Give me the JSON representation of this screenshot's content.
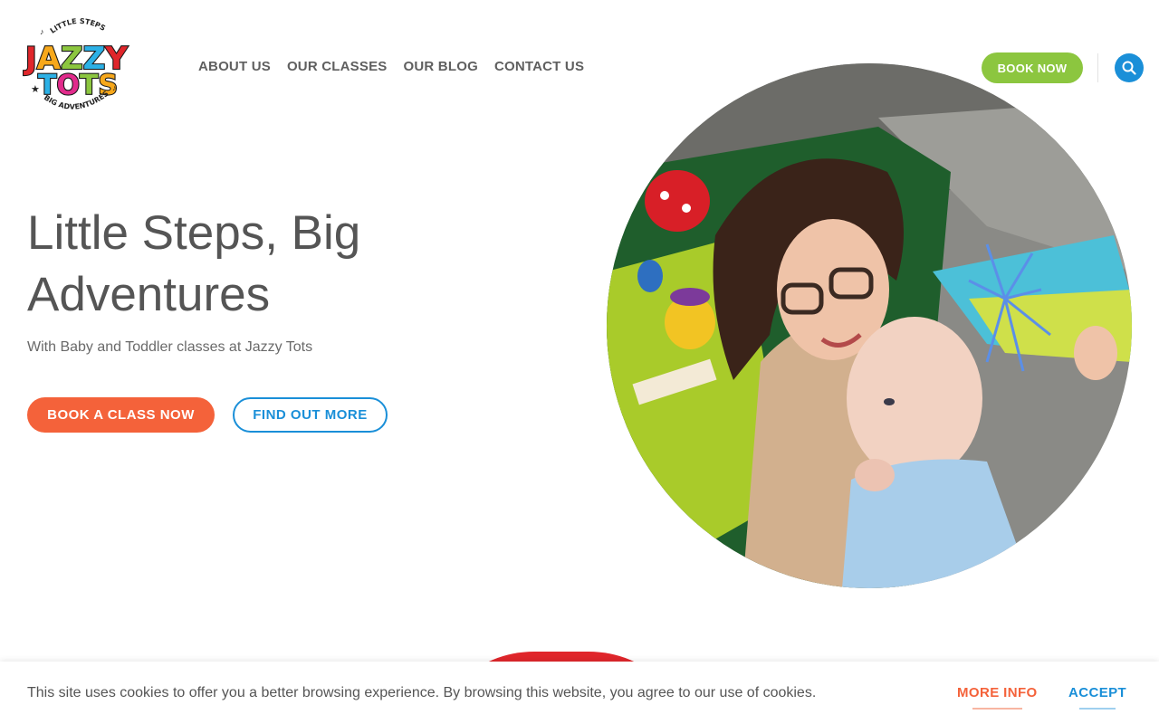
{
  "brand": {
    "logo_top": "LITTLE STEPS",
    "logo_line1": "JAZZY",
    "logo_line2": "TOTS",
    "logo_bottom": "BIG ADVENTURES"
  },
  "nav": {
    "items": [
      {
        "label": "ABOUT US"
      },
      {
        "label": "OUR CLASSES"
      },
      {
        "label": "OUR BLOG"
      },
      {
        "label": "CONTACT US"
      }
    ],
    "book_now": "BOOK NOW",
    "search_icon": "search-icon"
  },
  "hero": {
    "title": "Little Steps, Big Adventures",
    "subtitle": "With Baby and Toddler classes at Jazzy Tots",
    "primary_cta": "BOOK A CLASS NOW",
    "secondary_cta": "FIND OUT MORE"
  },
  "cookie": {
    "text": "This site uses cookies to offer you a better browsing experience. By browsing this website, you agree to our use of cookies.",
    "more_info": "MORE INFO",
    "accept": "ACCEPT"
  },
  "colors": {
    "accent_green": "#8cc63f",
    "accent_orange": "#f4623a",
    "accent_blue": "#1a8fd8",
    "accent_red": "#e0262b"
  }
}
